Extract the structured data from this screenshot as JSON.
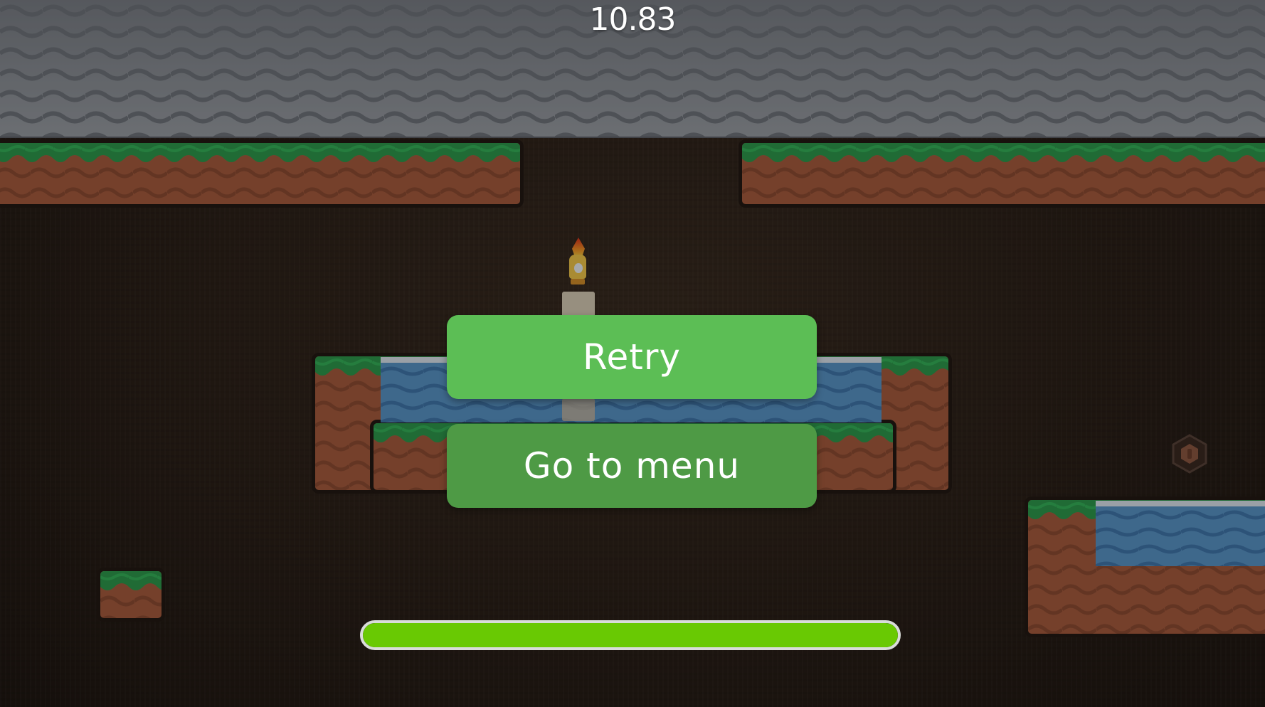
{
  "hud": {
    "timer": "10.83",
    "progress": 1.0
  },
  "menu": {
    "retry_label": "Retry",
    "menu_label": "Go to menu"
  },
  "colors": {
    "retry_button": "#5cbe55",
    "menu_button": "#4e9a45",
    "progress_fill": "#69c903",
    "ceiling": "#8b8f95",
    "grass": "#2f9a4c",
    "dirt": "#a85c3e",
    "water": "#5a95c7"
  },
  "icons": {
    "player": "flame-bird-character",
    "collectible": "hexagon-coin-icon"
  }
}
